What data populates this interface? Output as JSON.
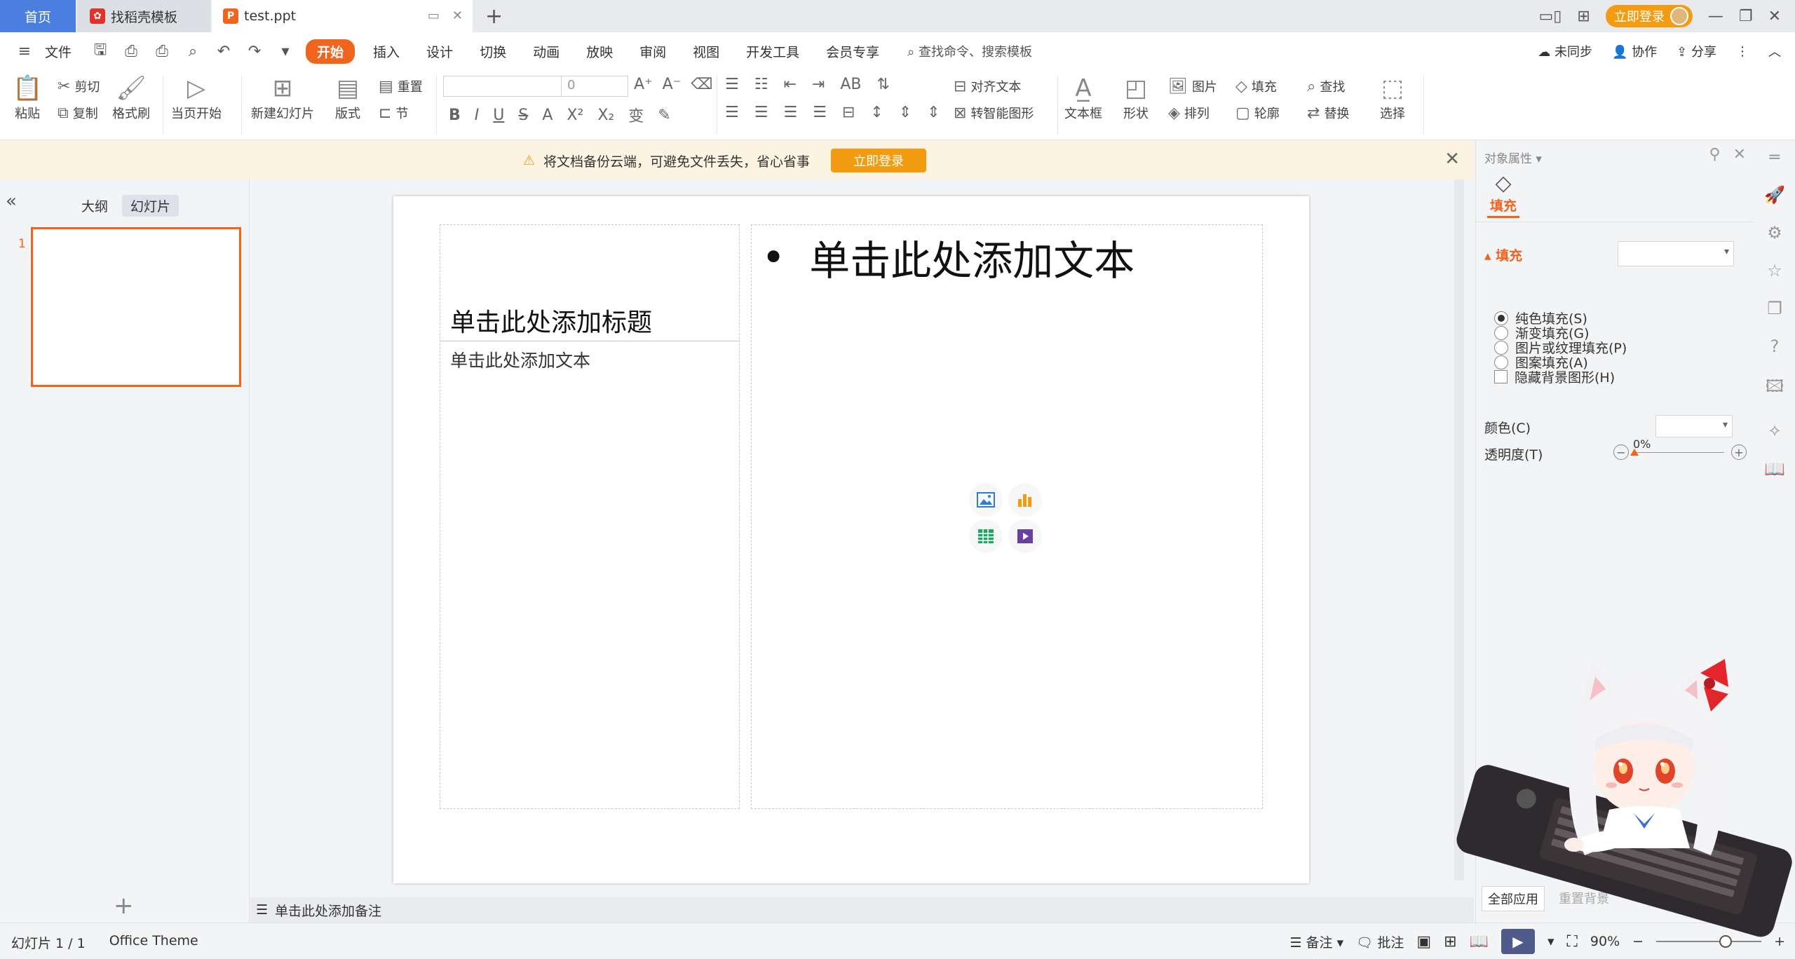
{
  "tabs": {
    "home": "首页",
    "template": "找稻壳模板",
    "file": "test.ppt"
  },
  "titlebar": {
    "login": "立即登录"
  },
  "menubar": {
    "file": "文件",
    "items": [
      "开始",
      "插入",
      "设计",
      "切换",
      "动画",
      "放映",
      "审阅",
      "视图",
      "开发工具",
      "会员专享"
    ],
    "search": "查找命令、搜索模板",
    "sync": "未同步",
    "collab": "协作",
    "share": "分享"
  },
  "ribbon": {
    "paste": "粘贴",
    "cut": "剪切",
    "copy": "复制",
    "format_painter": "格式刷",
    "play_from_current": "当页开始",
    "new_slide": "新建幻灯片",
    "layout": "版式",
    "section": "节",
    "reset": "重置",
    "font_size": "0",
    "align_text": "对齐文本",
    "smart_art": "转智能图形",
    "textbox": "文本框",
    "shapes": "形状",
    "picture": "图片",
    "arrange": "排列",
    "fill": "填充",
    "outline": "轮廓",
    "find": "查找",
    "replace": "替换",
    "select": "选择"
  },
  "notice": {
    "text": "将文档备份云端，可避免文件丢失，省心省事",
    "button": "立即登录"
  },
  "leftpanel": {
    "outline_tab": "大纲",
    "slides_tab": "幻灯片",
    "slide_number": "1"
  },
  "slide": {
    "left_title": "单击此处添加标题",
    "left_body": "单击此处添加文本",
    "content_bullet": "单击此处添加文本"
  },
  "notes": {
    "placeholder": "单击此处添加备注"
  },
  "properties": {
    "title": "对象属性",
    "fill_tab": "填充",
    "section": "填充",
    "options": [
      "纯色填充(S)",
      "渐变填充(G)",
      "图片或纹理填充(P)",
      "图案填充(A)"
    ],
    "hide_bg": "隐藏背景图形(H)",
    "color_label": "颜色(C)",
    "transparency_label": "透明度(T)",
    "transparency_value": "0%",
    "apply_all": "全部应用",
    "reset_bg": "重置背景"
  },
  "status": {
    "slide_count": "幻灯片 1 / 1",
    "theme": "Office Theme",
    "notes": "备注",
    "comments": "批注",
    "zoom": "90%"
  },
  "colors": {
    "accent": "#f0641e",
    "tab_home": "#4a7fe0",
    "login_pill": "#f39c12",
    "notice_bg": "#fdf3e2"
  }
}
